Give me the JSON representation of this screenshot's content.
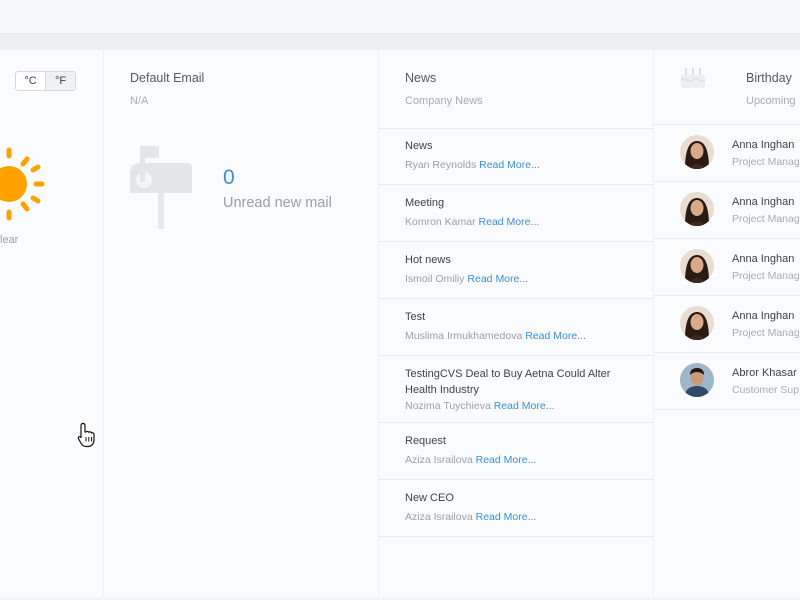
{
  "weather": {
    "unit_c": "°C",
    "unit_f": "°F",
    "active_unit": "F",
    "condition": "lear",
    "sun_color": "#FFA200"
  },
  "email": {
    "title": "Default Email",
    "subtitle": "N/A",
    "unread_count": "0",
    "unread_label": "Unread new mail"
  },
  "news": {
    "title": "News",
    "subtitle": "Company News",
    "read_more": "Read More...",
    "items": [
      {
        "title": "News",
        "author": "Ryan Reynolds"
      },
      {
        "title": "Meeting",
        "author": "Komron Kamar"
      },
      {
        "title": "Hot news",
        "author": "Ismoil Omiliy"
      },
      {
        "title": "Test",
        "author": "Muslima Irmukhamedova"
      },
      {
        "title": "TestingCVS Deal to Buy Aetna Could Alter Health Industry",
        "author": "Nozima Tuychieva"
      },
      {
        "title": "Request",
        "author": "Aziza Israilova"
      },
      {
        "title": "New CEO",
        "author": "Aziza Israilova"
      }
    ]
  },
  "birthdays": {
    "title": "Birthday",
    "subtitle": "Upcoming",
    "items": [
      {
        "name": "Anna Inghan",
        "role": "Project Manag"
      },
      {
        "name": "Anna Inghan",
        "role": "Project Manag"
      },
      {
        "name": "Anna Inghan",
        "role": "Project Manag"
      },
      {
        "name": "Anna Inghan",
        "role": "Project Manag"
      },
      {
        "name": "Abror Khasar",
        "role": "Customer Sup"
      }
    ]
  },
  "colors": {
    "accent": "#3B8FD6",
    "background": "#F3F5F8"
  }
}
